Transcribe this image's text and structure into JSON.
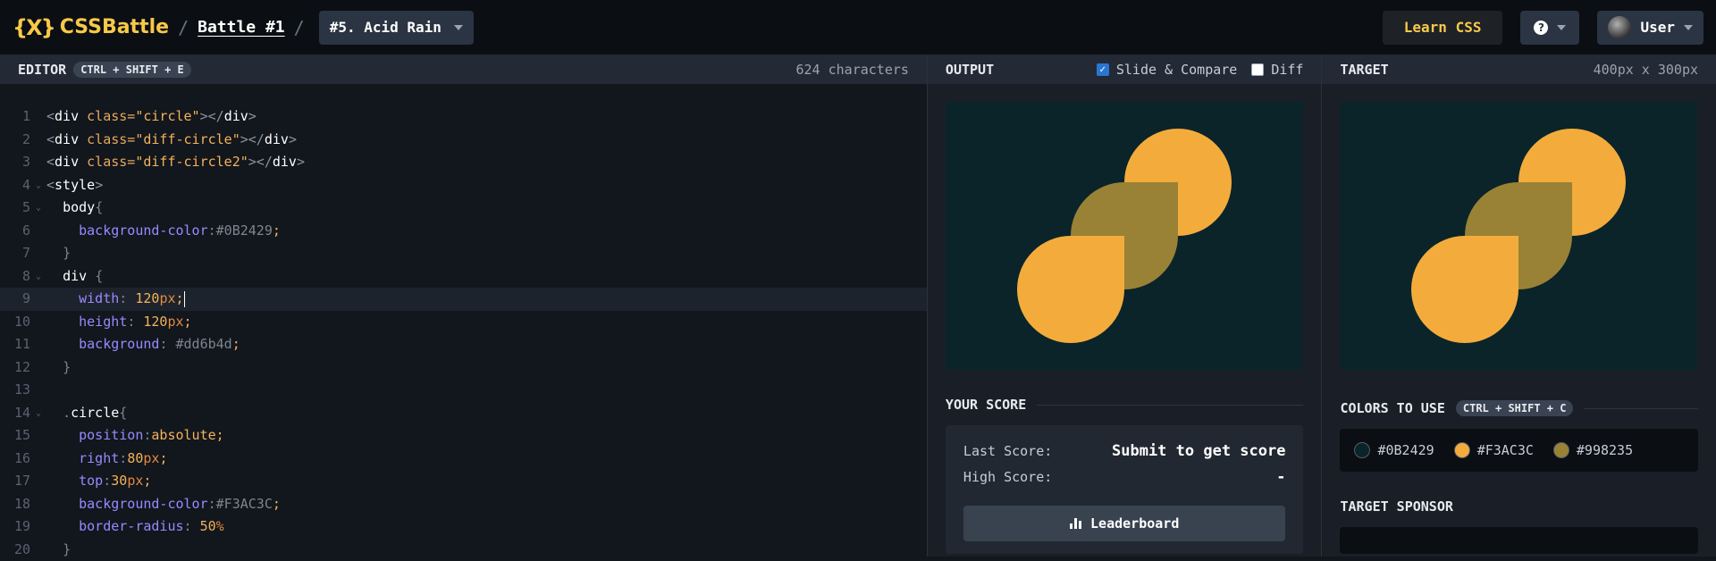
{
  "topbar": {
    "logo_mark": "{X}",
    "logo_text": "CSSBattle",
    "separator": "/",
    "battle": "Battle #1",
    "target_select": "#5. Acid Rain",
    "learn": "Learn CSS",
    "help": "?",
    "user": "User"
  },
  "editor": {
    "title": "EDITOR",
    "shortcut": "CTRL + SHIFT + E",
    "chars": "624 characters"
  },
  "code_lines": [
    {
      "n": "1"
    },
    {
      "n": "2"
    },
    {
      "n": "3"
    },
    {
      "n": "4"
    },
    {
      "n": "5"
    },
    {
      "n": "6"
    },
    {
      "n": "7"
    },
    {
      "n": "8"
    },
    {
      "n": "9"
    },
    {
      "n": "10"
    },
    {
      "n": "11"
    },
    {
      "n": "12"
    },
    {
      "n": "13"
    },
    {
      "n": "14"
    },
    {
      "n": "15"
    },
    {
      "n": "16"
    },
    {
      "n": "17"
    },
    {
      "n": "18"
    },
    {
      "n": "19"
    },
    {
      "n": "20"
    }
  ],
  "code": {
    "l1_tag_open": "<",
    "l1_name": "div",
    "l1_attr": " class=",
    "l1_val": "\"circle\"",
    "l1_close": "></",
    "l1_end": ">",
    "l2_attr": " class=",
    "l2_val": "\"diff-circle\"",
    "l3_attr": " class=",
    "l3_val": "\"diff-circle2\"",
    "l4_name": "style",
    "l5_sel": "body",
    "brace_open": "{",
    "brace_close": "}",
    "l6_prop": "background-color",
    "l6_val": "#0B2429",
    "l8_sel": "div ",
    "l9_prop": "width",
    "l9_num": "120",
    "l9_unit": "px",
    "l10_prop": "height",
    "l10_num": "120",
    "l10_unit": "px",
    "l11_prop": "background",
    "l11_val": "#dd6b4d",
    "l14_dot": ".",
    "l14_sel": "circle",
    "l15_prop": "position",
    "l15_val": "absolute",
    "l16_prop": "right",
    "l16_num": "80",
    "l16_unit": "px",
    "l17_prop": "top",
    "l17_num": "30",
    "l17_unit": "px",
    "l18_prop": "background-color",
    "l18_val": "#F3AC3C",
    "l19_prop": "border-radius",
    "l19_num": "50",
    "l19_unit": "%",
    "colon": ":",
    "colon_sp": ": ",
    "semi": ";"
  },
  "output": {
    "title": "OUTPUT",
    "slide_compare": "Slide & Compare",
    "slide_checked": true,
    "diff": "Diff",
    "check_glyph": "✓"
  },
  "score": {
    "title": "YOUR SCORE",
    "last_label": "Last Score:",
    "last_value": "Submit to get score",
    "high_label": "High Score:",
    "high_value": "-",
    "leaderboard": "Leaderboard"
  },
  "target": {
    "title": "TARGET",
    "size": "400px x 300px",
    "colors_title": "COLORS TO USE",
    "colors_shortcut": "CTRL + SHIFT + C",
    "colors": [
      {
        "hex": "#0B2429"
      },
      {
        "hex": "#F3AC3C"
      },
      {
        "hex": "#998235"
      }
    ],
    "sponsor_title": "TARGET SPONSOR"
  }
}
